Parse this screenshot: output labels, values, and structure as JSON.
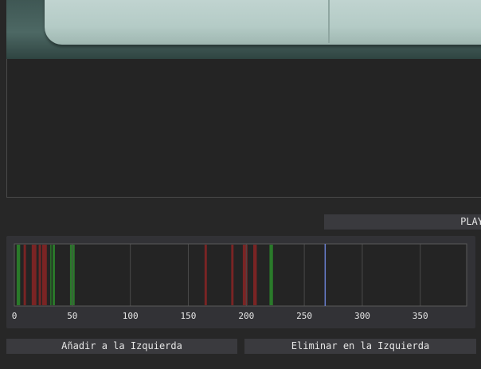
{
  "play_button_label": "PLAY",
  "buttons": {
    "add_left": "Añadir a la Izquierda",
    "remove_left": "Eliminar en la Izquierda"
  },
  "colors": {
    "background": "#272727",
    "panel": "#323236",
    "button": "#3a3a3e",
    "keep_segment": "#2a7a2a",
    "cut_segment": "#7a2424",
    "playhead": "#6a7fd0"
  },
  "timeline": {
    "axis_ticks": [
      0,
      50,
      100,
      150,
      200,
      250,
      300,
      350
    ],
    "x_min": 0,
    "x_max": 390,
    "playhead": 268,
    "segments": [
      {
        "start": 2,
        "end": 5,
        "kind": "keep"
      },
      {
        "start": 8,
        "end": 10,
        "kind": "cut"
      },
      {
        "start": 15,
        "end": 19,
        "kind": "cut"
      },
      {
        "start": 21,
        "end": 23,
        "kind": "cut"
      },
      {
        "start": 24,
        "end": 28,
        "kind": "cut"
      },
      {
        "start": 31,
        "end": 32,
        "kind": "keep"
      },
      {
        "start": 33,
        "end": 35,
        "kind": "keep"
      },
      {
        "start": 48,
        "end": 52,
        "kind": "keep"
      },
      {
        "start": 164,
        "end": 166,
        "kind": "cut"
      },
      {
        "start": 187,
        "end": 189,
        "kind": "cut"
      },
      {
        "start": 197,
        "end": 201,
        "kind": "cut"
      },
      {
        "start": 206,
        "end": 209,
        "kind": "cut"
      },
      {
        "start": 220,
        "end": 223,
        "kind": "keep"
      }
    ]
  }
}
